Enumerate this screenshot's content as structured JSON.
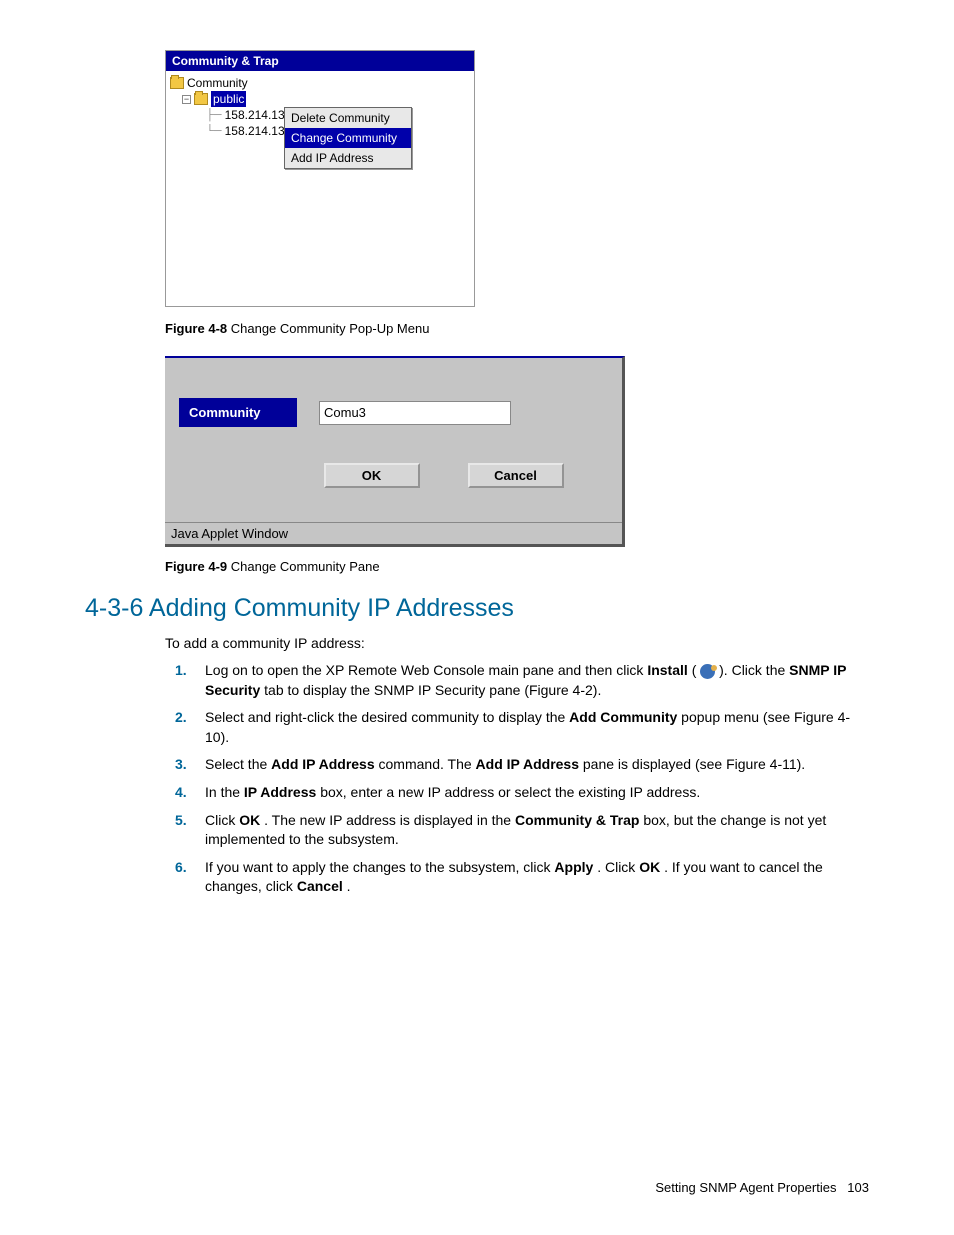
{
  "fig48": {
    "panel_title": "Community & Trap",
    "tree": {
      "root": "Community",
      "sel": "public",
      "ip1": "158.214.133.1",
      "ip2": "158.214.135.1"
    },
    "menu": {
      "delete": "Delete Community",
      "change": "Change Community",
      "add": "Add IP Address"
    },
    "caption_label": "Figure 4-8",
    "caption_text": " Change Community Pop-Up Menu"
  },
  "fig49": {
    "field_label": "Community",
    "field_value": "Comu3",
    "ok": "OK",
    "cancel": "Cancel",
    "status": "Java Applet Window",
    "caption_label": "Figure 4-9",
    "caption_text": " Change Community Pane"
  },
  "section": {
    "heading": "4-3-6 Adding Community IP Addresses",
    "intro": "To add a community IP address:",
    "s1a": "Log on to open the XP Remote Web Console main pane and then click ",
    "s1_install_b": "Install",
    "s1b": " ( ",
    "s1c": " ). Click the ",
    "s1_snmp_b": "SNMP IP Security",
    "s1d": " tab to display the SNMP IP Security pane (Figure 4-2).",
    "s2a": "Select and right-click the desired community to display the ",
    "s2_b": "Add Community",
    "s2b": " popup menu (see Figure 4-10).",
    "s3a": "Select the ",
    "s3_b1": "Add IP Address",
    "s3b": " command. The ",
    "s3_b2": "Add IP Address",
    "s3c": " pane is displayed (see Figure 4-11).",
    "s4a": "In the ",
    "s4_b": "IP Address",
    "s4b": " box, enter a new IP address or select the existing IP address.",
    "s5a": "Click ",
    "s5_b1": "OK",
    "s5b": ". The new IP address is displayed in the ",
    "s5_b2": "Community & Trap",
    "s5c": " box, but the change is not yet implemented to the subsystem.",
    "s6a": "If you want to apply the changes to the subsystem, click ",
    "s6_b1": "Apply",
    "s6b": ". Click ",
    "s6_b2": "OK",
    "s6c": ". If you want to cancel the changes, click ",
    "s6_b3": "Cancel",
    "s6d": "."
  },
  "footer": {
    "title": "Setting SNMP Agent Properties",
    "page": "103"
  }
}
